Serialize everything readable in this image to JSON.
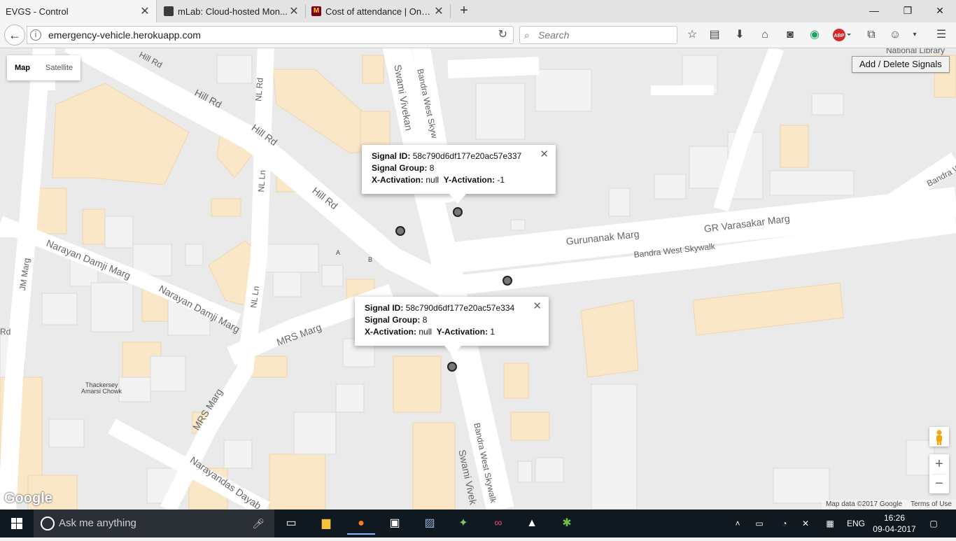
{
  "browser": {
    "tabs": [
      {
        "title": "EVGS - Control",
        "active": true
      },
      {
        "title": "mLab: Cloud-hosted Mon...",
        "active": false
      },
      {
        "title": "Cost of attendance | One ...",
        "active": false
      }
    ],
    "url": "emergency-vehicle.herokuapp.com",
    "search_placeholder": "Search"
  },
  "map": {
    "map_type_options": [
      "Map",
      "Satellite"
    ],
    "selected_map_type": "Map",
    "add_delete_button": "Add / Delete Signals",
    "street_labels": [
      "Hill Rd",
      "Hill Rd",
      "Hill Rd",
      "Hill Rd",
      "NL Rd",
      "NL Ln",
      "NL Ln",
      "Swami Vivekan",
      "Bandra West Skyw",
      "Gurunanak Marg",
      "GR Varasakar Marg",
      "Bandra West Skywalk",
      "Narayan Damji Marg",
      "Narayan Damji Marg",
      "JM Marg",
      "MRS Marg",
      "MRS Marg",
      "Narayandas Dayab",
      "Bandra West Skywalk",
      "Swami Vivek",
      "Bandra W",
      "National Library",
      "Rd"
    ],
    "place_labels": [
      "Thackersey",
      "Amarsi Chowk",
      "A",
      "B"
    ],
    "info_windows": [
      {
        "signal_id_label": "Signal ID:",
        "signal_id": "58c790d6df177e20ac57e337",
        "group_label": "Signal Group:",
        "group": "8",
        "x_label": "X-Activation:",
        "x": "null",
        "y_label": "Y-Activation:",
        "y": "-1"
      },
      {
        "signal_id_label": "Signal ID:",
        "signal_id": "58c790d6df177e20ac57e334",
        "group_label": "Signal Group:",
        "group": "8",
        "x_label": "X-Activation:",
        "x": "null",
        "y_label": "Y-Activation:",
        "y": "1"
      }
    ],
    "zoom_in": "+",
    "zoom_out": "−",
    "google_logo": "Google",
    "map_data": "Map data ©2017 Google",
    "terms": "Terms of Use"
  },
  "taskbar": {
    "search_text": "Ask me anything",
    "language": "ENG",
    "time": "16:26",
    "date": "09-04-2017"
  },
  "colors": {
    "road": "#ffffff",
    "building": "#fae7c8",
    "land": "#eaeaea",
    "marker": "#777777"
  }
}
